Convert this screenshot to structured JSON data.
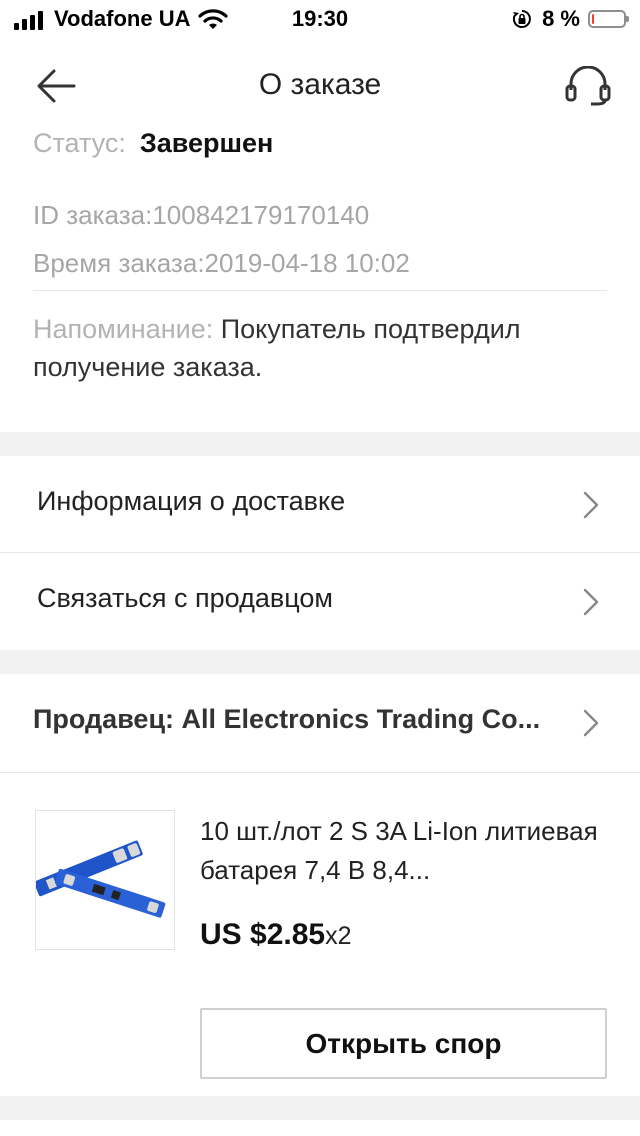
{
  "status_bar": {
    "carrier": "Vodafone UA",
    "time": "19:30",
    "battery_percent": "8 %",
    "battery_level": 0.08,
    "battery_color": "#ff3b30"
  },
  "nav": {
    "title": "О заказе",
    "back_icon": "arrow-left-icon",
    "support_icon": "headset-icon"
  },
  "order": {
    "status_label": "Статус:",
    "status_value": "Завершен",
    "id_line": "ID заказа:100842179170140",
    "time_line": "Время заказа:2019-04-18 10:02",
    "reminder_label": "Напоминание:",
    "reminder_text": " Покупатель подтвердил получение заказа."
  },
  "links": {
    "delivery_info": "Информация о доставке",
    "contact_seller": "Связаться с продавцом",
    "chevron_icon": "chevron-right-icon"
  },
  "seller": {
    "label": "Продавец: All Electronics Trading Co..."
  },
  "product": {
    "title": "10 шт./лот 2 S 3A Li-Ion литиевая батарея 7,4 В 8,4...",
    "price": "US $2.85",
    "quantity": "x2",
    "image_icon": "battery-protection-board-image"
  },
  "actions": {
    "open_dispute": "Открыть спор"
  },
  "colors": {
    "background": "#ffffff",
    "section_gap": "#f2f2f2",
    "muted_text": "#a6a6a6"
  }
}
